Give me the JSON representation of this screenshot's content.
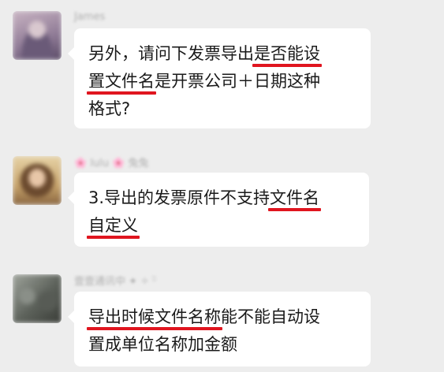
{
  "messages": [
    {
      "sender": "James",
      "lines": [
        {
          "plain": "另外，请问下发票导出",
          "marked": "是否能设",
          "after": ""
        },
        {
          "plain": "",
          "marked": "置文件名",
          "after": "是开票公司＋日期这种"
        },
        {
          "plain": "格式?",
          "marked": "",
          "after": ""
        }
      ]
    },
    {
      "sender": "🌸 lulu 🌸 兔兔",
      "lines": [
        {
          "plain": "3.导出的发票原件不支持",
          "marked": "文件名",
          "after": ""
        },
        {
          "plain": "",
          "marked": "自定义",
          "after": ""
        }
      ]
    },
    {
      "sender": "壹壹通讯中 ✦ ✧ ᵕ̈",
      "lines": [
        {
          "plain": "",
          "marked": "导出时候文件名称",
          "after": "能不能自动设"
        },
        {
          "plain": "置成单位名称加金额",
          "marked": "",
          "after": ""
        }
      ]
    }
  ],
  "colors": {
    "background": "#ededed",
    "bubble": "#ffffff",
    "underline": "#e0151f"
  }
}
